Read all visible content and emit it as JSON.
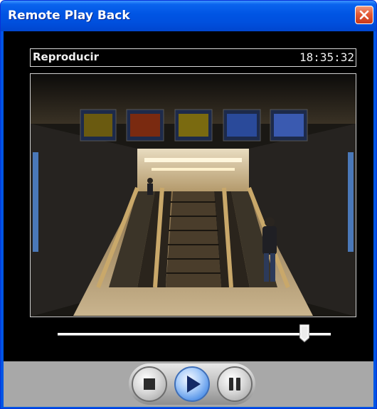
{
  "window": {
    "title": "Remote Play Back"
  },
  "status": {
    "mode": "Reproducir",
    "time": "18:35:32"
  },
  "playback": {
    "position_fraction": 0.92
  },
  "controls": {
    "stop": "stop-icon",
    "play": "play-icon",
    "pause": "pause-icon"
  },
  "colors": {
    "title_bar": "#0054e3",
    "close_button": "#e35a35",
    "play_button": "#4b8de6",
    "control_bar": "#a8a8a8"
  }
}
